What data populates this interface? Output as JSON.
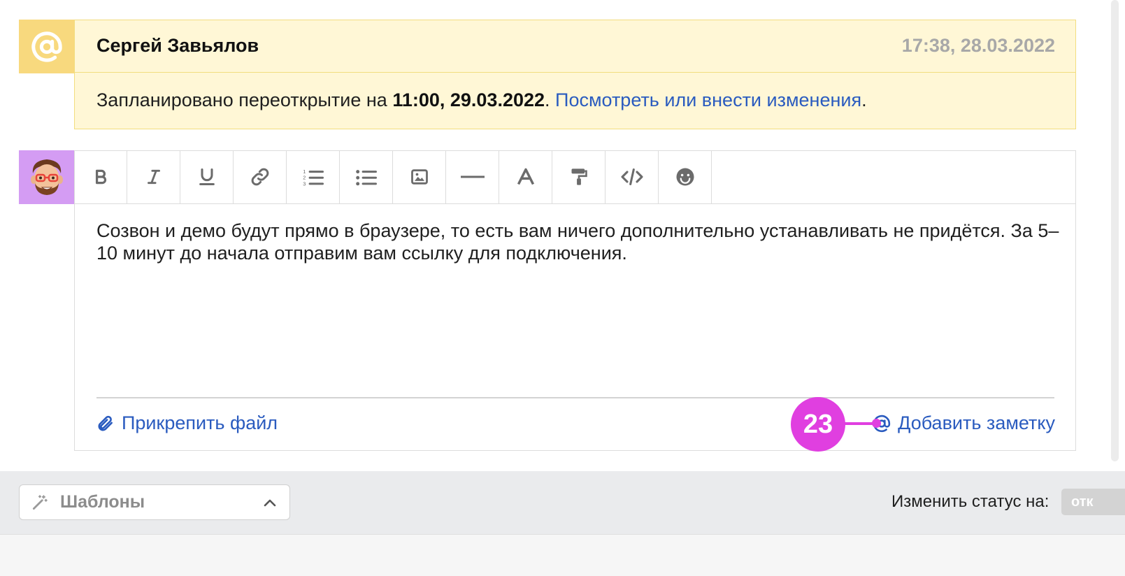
{
  "note": {
    "icon": "at-sign-icon",
    "author": "Сергей Завьялов",
    "timestamp": "17:38, 28.03.2022",
    "text_prefix": "Запланировано переоткрытие на ",
    "datetime_bold": "11:00, 29.03.2022",
    "text_dot": ". ",
    "link_text": "Посмотреть или внести изменения",
    "text_suffix": "."
  },
  "editor": {
    "avatar": "memoji-avatar",
    "toolbar": [
      {
        "name": "bold-icon"
      },
      {
        "name": "italic-icon"
      },
      {
        "name": "underline-icon"
      },
      {
        "name": "link-icon"
      },
      {
        "name": "ordered-list-icon"
      },
      {
        "name": "bullet-list-icon"
      },
      {
        "name": "image-icon"
      },
      {
        "name": "horizontal-rule-icon"
      },
      {
        "name": "text-color-icon"
      },
      {
        "name": "format-paint-icon"
      },
      {
        "name": "code-icon"
      },
      {
        "name": "emoji-icon"
      }
    ],
    "content": "Созвон и демо будут прямо в браузере, то есть вам ничего дополнительно устанавливать не придётся. За 5–10 минут до начала отправим вам ссылку для подключения.",
    "attach_label": "Прикрепить файл",
    "add_note_label": "Добавить заметку"
  },
  "callout": {
    "number": "23",
    "color": "#e03fe0"
  },
  "footer": {
    "templates_label": "Шаблоны",
    "status_label": "Изменить статус на:",
    "status_pill": "отк"
  },
  "colors": {
    "note_bg": "#fff7d6",
    "note_icon_bg": "#f8d97e",
    "avatar_bg": "#d49cf3",
    "link": "#2a5bbf"
  }
}
